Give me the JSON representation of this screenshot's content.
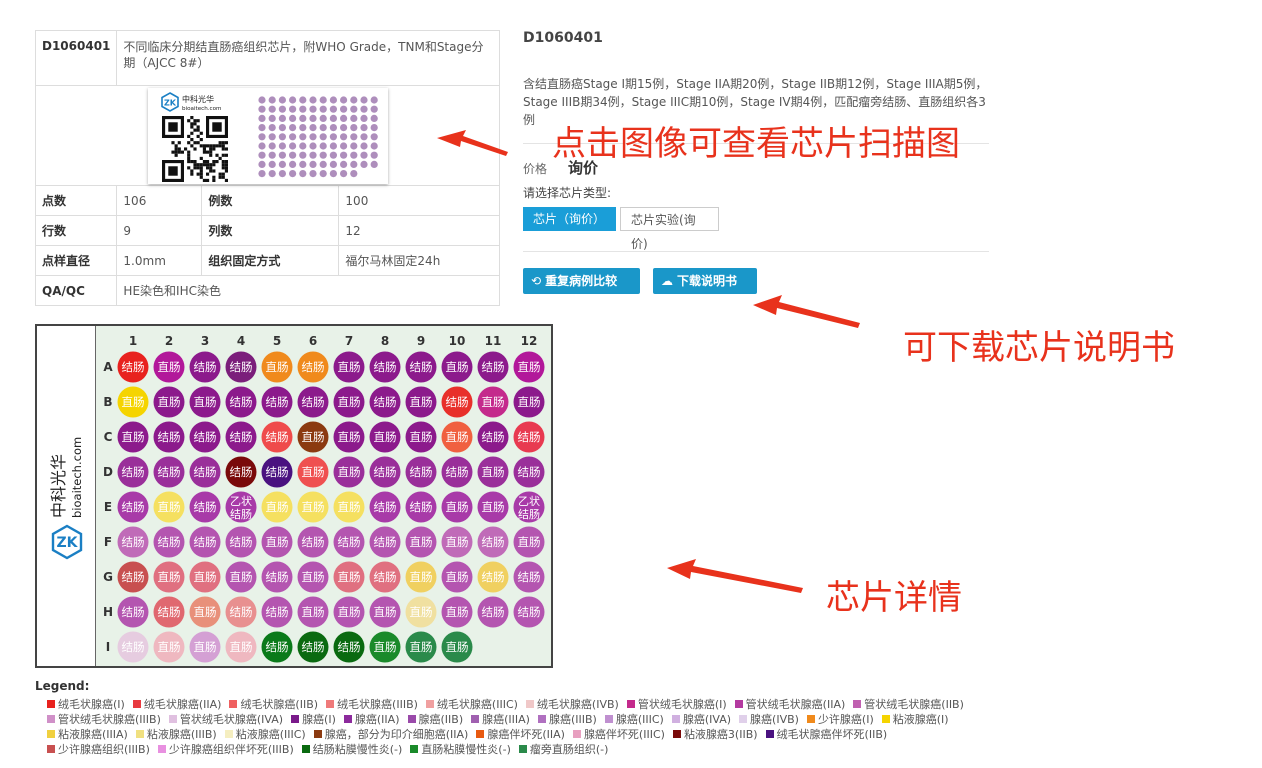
{
  "product": {
    "code": "D1060401",
    "title": "不同临床分期结直肠癌组织芯片，附WHO Grade，TNM和Stage分期（AJCC 8#）",
    "description": "含结直肠癌Stage I期15例，Stage IIA期20例，Stage IIB期12例，Stage IIIA期5例，Stage IIIB期34例，Stage IIIC期10例，Stage IV期4例，匹配瘤旁结肠、直肠组织各3例"
  },
  "thumb": {
    "logo_cn": "中科光华",
    "logo_en": "bioaitech.com",
    "logo_mark": "ZK"
  },
  "specs": {
    "dots_label": "点数",
    "dots": "106",
    "cases_label": "例数",
    "cases": "100",
    "rows_label": "行数",
    "rows": "9",
    "cols_label": "列数",
    "cols": "12",
    "diameter_label": "点样直径",
    "diameter": "1.0mm",
    "fixation_label": "组织固定方式",
    "fixation": "福尔马林固定24h",
    "qa_label": "QA/QC",
    "qa": "HE染色和IHC染色"
  },
  "price": {
    "label": "价格",
    "value": "询价"
  },
  "chip_type": {
    "label": "请选择芯片类型:",
    "options": [
      "芯片（询价）",
      "芯片实验(询价)"
    ]
  },
  "buttons": {
    "compare": "重复病例比较",
    "download": "下载说明书"
  },
  "annotations": {
    "scan": "点击图像可查看芯片扫描图",
    "manual": "可下载芯片说明书",
    "detail": "芯片详情"
  },
  "plate": {
    "brand_cn": "中科光华",
    "brand_en": "bioaitech.com",
    "brand_mark": "ZK",
    "col_labels": [
      "1",
      "2",
      "3",
      "4",
      "5",
      "6",
      "7",
      "8",
      "9",
      "10",
      "11",
      "12"
    ],
    "row_labels": [
      "A",
      "B",
      "C",
      "D",
      "E",
      "F",
      "G",
      "H",
      "I"
    ],
    "cells": [
      [
        [
          "结肠",
          "#e8221e"
        ],
        [
          "直肠",
          "#b2189a"
        ],
        [
          "结肠",
          "#8c1a8c"
        ],
        [
          "结肠",
          "#7b1e7b"
        ],
        [
          "直肠",
          "#f08a1c"
        ],
        [
          "结肠",
          "#f08a1c"
        ],
        [
          "直肠",
          "#8c1a8c"
        ],
        [
          "结肠",
          "#8c1a8c"
        ],
        [
          "结肠",
          "#8c1a8c"
        ],
        [
          "直肠",
          "#8c1a8c"
        ],
        [
          "结肠",
          "#8c1a8c"
        ],
        [
          "直肠",
          "#b2189a"
        ]
      ],
      [
        [
          "直肠",
          "#f5d400"
        ],
        [
          "直肠",
          "#8c1a8c"
        ],
        [
          "直肠",
          "#8c1a8c"
        ],
        [
          "结肠",
          "#8c1a8c"
        ],
        [
          "结肠",
          "#8c1a8c"
        ],
        [
          "结肠",
          "#8c1a8c"
        ],
        [
          "直肠",
          "#8c1a8c"
        ],
        [
          "结肠",
          "#8c1a8c"
        ],
        [
          "直肠",
          "#8c1a8c"
        ],
        [
          "结肠",
          "#e8302a"
        ],
        [
          "直肠",
          "#c42a8c"
        ],
        [
          "直肠",
          "#8c1a8c"
        ]
      ],
      [
        [
          "直肠",
          "#8c1a8c"
        ],
        [
          "结肠",
          "#8c1a8c"
        ],
        [
          "结肠",
          "#8c1a8c"
        ],
        [
          "结肠",
          "#8c1a8c"
        ],
        [
          "结肠",
          "#ef4b4b"
        ],
        [
          "直肠",
          "#8b3a10"
        ],
        [
          "直肠",
          "#8c1a8c"
        ],
        [
          "直肠",
          "#8c1a8c"
        ],
        [
          "直肠",
          "#8c1a8c"
        ],
        [
          "直肠",
          "#f06040"
        ],
        [
          "结肠",
          "#8c1a8c"
        ],
        [
          "结肠",
          "#e83a50"
        ]
      ],
      [
        [
          "结肠",
          "#9a2f9a"
        ],
        [
          "结肠",
          "#9a2f9a"
        ],
        [
          "结肠",
          "#9a2f9a"
        ],
        [
          "结肠",
          "#7a0a0a"
        ],
        [
          "结肠",
          "#4a1280"
        ],
        [
          "直肠",
          "#ef5050"
        ],
        [
          "直肠",
          "#9a2f9a"
        ],
        [
          "结肠",
          "#9a2f9a"
        ],
        [
          "结肠",
          "#9a2f9a"
        ],
        [
          "结肠",
          "#9a2f9a"
        ],
        [
          "直肠",
          "#9a2f9a"
        ],
        [
          "结肠",
          "#9a2f9a"
        ]
      ],
      [
        [
          "结肠",
          "#a83aa8"
        ],
        [
          "直肠",
          "#f5e060"
        ],
        [
          "结肠",
          "#a83aa8"
        ],
        [
          "乙状结肠",
          "#a83aa8"
        ],
        [
          "直肠",
          "#f5e060"
        ],
        [
          "直肠",
          "#f5e060"
        ],
        [
          "直肠",
          "#f5e060"
        ],
        [
          "结肠",
          "#a83aa8"
        ],
        [
          "结肠",
          "#a83aa8"
        ],
        [
          "直肠",
          "#a83aa8"
        ],
        [
          "直肠",
          "#a83aa8"
        ],
        [
          "乙状结肠",
          "#a83aa8"
        ]
      ],
      [
        [
          "结肠",
          "#c06bb8"
        ],
        [
          "结肠",
          "#b455b0"
        ],
        [
          "结肠",
          "#b455b0"
        ],
        [
          "结肠",
          "#b455b0"
        ],
        [
          "直肠",
          "#b455b0"
        ],
        [
          "结肠",
          "#b455b0"
        ],
        [
          "结肠",
          "#b455b0"
        ],
        [
          "结肠",
          "#b455b0"
        ],
        [
          "直肠",
          "#b455b0"
        ],
        [
          "直肠",
          "#c06bb8"
        ],
        [
          "结肠",
          "#c06bb8"
        ],
        [
          "直肠",
          "#b455b0"
        ]
      ],
      [
        [
          "结肠",
          "#c85050"
        ],
        [
          "直肠",
          "#e07080"
        ],
        [
          "直肠",
          "#e07080"
        ],
        [
          "直肠",
          "#b455b0"
        ],
        [
          "结肠",
          "#b455b0"
        ],
        [
          "直肠",
          "#b455b0"
        ],
        [
          "直肠",
          "#e07080"
        ],
        [
          "结肠",
          "#e07080"
        ],
        [
          "直肠",
          "#f0d060"
        ],
        [
          "直肠",
          "#b455b0"
        ],
        [
          "结肠",
          "#f0d060"
        ],
        [
          "结肠",
          "#b455b0"
        ]
      ],
      [
        [
          "结肠",
          "#b455b0"
        ],
        [
          "结肠",
          "#e06870"
        ],
        [
          "直肠",
          "#e8907a"
        ],
        [
          "结肠",
          "#e89090"
        ],
        [
          "结肠",
          "#b455b0"
        ],
        [
          "直肠",
          "#b455b0"
        ],
        [
          "直肠",
          "#b455b0"
        ],
        [
          "直肠",
          "#b455b0"
        ],
        [
          "直肠",
          "#f0e0a0"
        ],
        [
          "直肠",
          "#b455b0"
        ],
        [
          "结肠",
          "#b455b0"
        ],
        [
          "结肠",
          "#b455b0"
        ]
      ],
      [
        [
          "结肠",
          "#e6cce0"
        ],
        [
          "直肠",
          "#efb8c0"
        ],
        [
          "直肠",
          "#d4a0d4"
        ],
        [
          "直肠",
          "#efb8c0"
        ],
        [
          "结肠",
          "#0a7a1a"
        ],
        [
          "结肠",
          "#0a6a10"
        ],
        [
          "结肠",
          "#0a6a10"
        ],
        [
          "直肠",
          "#1a8a2a"
        ],
        [
          "直肠",
          "#2a8a4a"
        ],
        [
          "直肠",
          "#2a8a4a"
        ]
      ]
    ]
  },
  "legend": {
    "title": "Legend:",
    "items": [
      [
        "绒毛状腺癌(I)",
        "#e8221e"
      ],
      [
        "绒毛状腺癌(IIA)",
        "#e83a40"
      ],
      [
        "绒毛状腺癌(IIB)",
        "#ef6060"
      ],
      [
        "绒毛状腺癌(IIIB)",
        "#ef7a7a"
      ],
      [
        "绒毛状腺癌(IIIC)",
        "#f0a0a0"
      ],
      [
        "绒毛状腺癌(IVB)",
        "#f0c8c8"
      ],
      [
        "管状绒毛状腺癌(I)",
        "#c42a8c"
      ],
      [
        "管状绒毛状腺癌(IIA)",
        "#b43aa0"
      ],
      [
        "管状绒毛状腺癌(IIB)",
        "#c060b0"
      ],
      [
        "管状绒毛状腺癌(IIIB)",
        "#d090c8"
      ],
      [
        "管状绒毛状腺癌(IVA)",
        "#e0c0e0"
      ],
      [
        "腺癌(I)",
        "#7a1a8a"
      ],
      [
        "腺癌(IIA)",
        "#8c2a9c"
      ],
      [
        "腺癌(IIB)",
        "#9a4aaa"
      ],
      [
        "腺癌(IIIA)",
        "#a060b0"
      ],
      [
        "腺癌(IIIB)",
        "#b070c0"
      ],
      [
        "腺癌(IIIC)",
        "#c090d0"
      ],
      [
        "腺癌(IVA)",
        "#d0b0e0"
      ],
      [
        "腺癌(IVB)",
        "#e0d0ea"
      ],
      [
        "少许腺癌(I)",
        "#f08a1c"
      ],
      [
        "粘液腺癌(I)",
        "#f5d400"
      ],
      [
        "粘液腺癌(IIIA)",
        "#f0d040"
      ],
      [
        "粘液腺癌(IIIB)",
        "#f0e080"
      ],
      [
        "粘液腺癌(IIIC)",
        "#f5eec0"
      ],
      [
        "腺癌，部分为印介细胞癌(IIA)",
        "#8b3a10"
      ],
      [
        "腺癌伴坏死(IIA)",
        "#e85a10"
      ],
      [
        "腺癌伴坏死(IIIC)",
        "#e8a0c0"
      ],
      [
        "粘液腺癌3(IIB)",
        "#7a0a0a"
      ],
      [
        "绒毛状腺癌伴坏死(IIB)",
        "#4a1280"
      ],
      [
        "少许腺癌组织(IIIB)",
        "#c85050"
      ],
      [
        "少许腺癌组织伴坏死(IIIB)",
        "#e890e0"
      ],
      [
        "结肠粘膜慢性炎(-)",
        "#0a6a10"
      ],
      [
        "直肠粘膜慢性炎(-)",
        "#1a8a2a"
      ],
      [
        "瘤旁直肠组织(-)",
        "#2a8a4a"
      ]
    ]
  }
}
